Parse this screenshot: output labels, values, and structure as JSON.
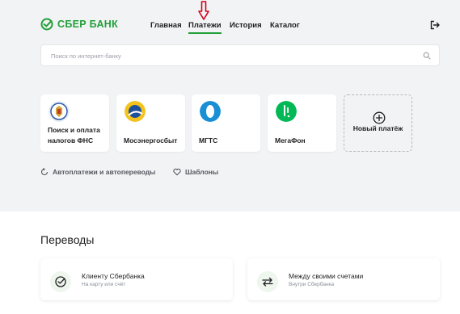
{
  "brand": {
    "name": "СБЕР БАНК",
    "accent": "#21a038"
  },
  "nav": {
    "items": [
      {
        "label": "Главная",
        "active": false
      },
      {
        "label": "Платежи",
        "active": true
      },
      {
        "label": "История",
        "active": false
      },
      {
        "label": "Каталог",
        "active": false
      }
    ]
  },
  "header": {
    "logout_icon": "logout-icon"
  },
  "search": {
    "placeholder": "Поиск по интернет-банку",
    "icon": "search-icon"
  },
  "tiles": [
    {
      "label_line1": "Поиск и оплата",
      "label_line2": "налогов ФНС",
      "icon": "fns-emblem-icon"
    },
    {
      "label_line1": "",
      "label_line2": "Мосэнергосбыт",
      "icon": "mosenergosbyt-icon"
    },
    {
      "label_line1": "",
      "label_line2": "МГТС",
      "icon": "mgts-icon"
    },
    {
      "label_line1": "",
      "label_line2": "МегаФон",
      "icon": "megafon-icon"
    },
    {
      "label_line1": "",
      "label_line2": "Новый платёж",
      "icon": "plus-circle-icon"
    }
  ],
  "links": [
    {
      "label": "Автоплатежи и автопереводы",
      "icon": "autopay-icon"
    },
    {
      "label": "Шаблоны",
      "icon": "heart-icon"
    }
  ],
  "transfers": {
    "title": "Переводы",
    "cards": [
      {
        "title": "Клиенту Сбербанка",
        "subtitle": "На карту или счёт",
        "icon": "sber-client-icon"
      },
      {
        "title": "Между своими счетами",
        "subtitle": "Внутри Сбербанка",
        "icon": "own-accounts-icon"
      }
    ]
  }
}
